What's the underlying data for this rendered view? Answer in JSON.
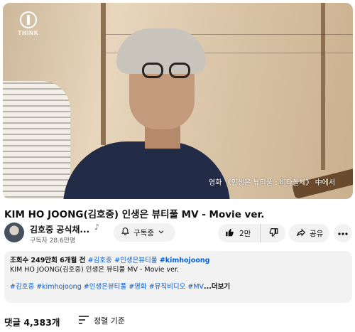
{
  "video": {
    "brand_logo_text": "THINK",
    "caption": "영화 《인생은 뷰티풀 : 비타돌체》 中에서",
    "title": "KIM HO JOONG(김호중) 인생은 뷰티풀 MV - Movie ver."
  },
  "channel": {
    "name": "김호중 공식채...",
    "subscribers": "구독자 28.6만명",
    "subscribe_label": "구독중",
    "icons": {
      "note": "music-note-icon",
      "bell": "bell-icon",
      "chevron": "chevron-down-icon"
    }
  },
  "actions": {
    "like_count": "2만",
    "share_label": "공유",
    "icons": {
      "like": "thumbs-up-icon",
      "dislike": "thumbs-down-icon",
      "share": "share-icon",
      "more": "more-icon"
    }
  },
  "description": {
    "views": "조회수 249만회",
    "age": "6개월 전",
    "tag1": "#김호중",
    "tag2": "#인생은뷰티풀",
    "tag3": "#kimhojoong",
    "line2": "KIM HO JOONG(김호중) 인생은 뷰티풀 MV - Movie ver.",
    "hashtags": [
      "#김호중",
      "#kimhojoong",
      "#인생은뷰티풀",
      "#영화",
      "#뮤직비디오",
      "#MV"
    ],
    "more_label": "...더보기"
  },
  "comments": {
    "count_label": "댓글 4,383개",
    "sort_label": "정렬 기준",
    "sort_icon": "sort-icon"
  },
  "colors": {
    "link": "#065fd4",
    "pill_bg": "#f2f2f2",
    "secondary_text": "#606060"
  }
}
